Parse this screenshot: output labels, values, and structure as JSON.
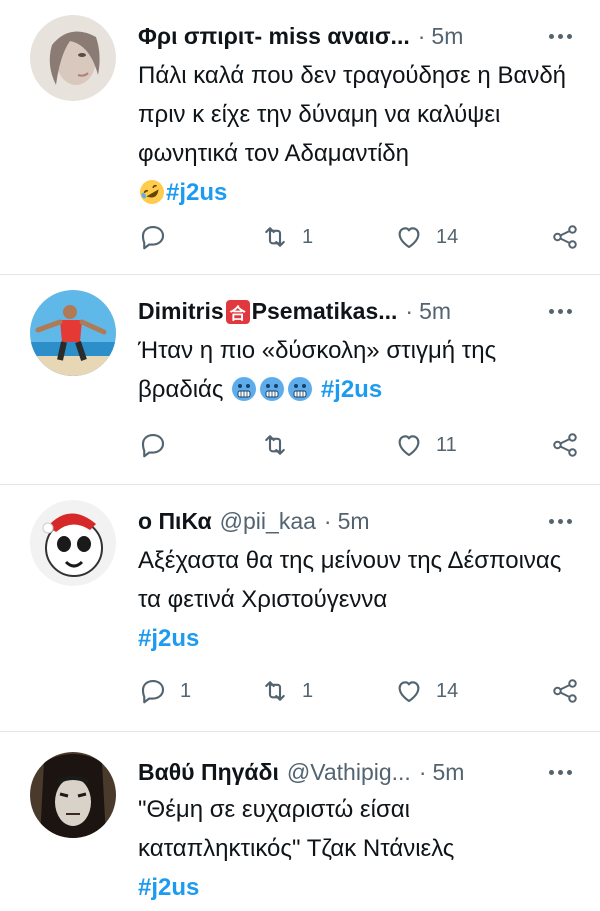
{
  "tweets": [
    {
      "name": "Φρι σπιριτ- miss αναισ...",
      "handle": "",
      "time": "5m",
      "text": "Πάλι καλά που δεν τραγούδησε η Βανδή πριν κ είχε την δύναμη να καλύψει φωνητικά τον Αδαμαντίδη",
      "hashtag": "#j2us",
      "emoji": "rolling-on-floor-laughing",
      "replies": "",
      "retweets": "1",
      "likes": "14"
    },
    {
      "name_part1": "Dimitris",
      "name_badge": "合",
      "name_part2": "Psematikas...",
      "handle": "",
      "time": "5m",
      "text": "Ήταν η πιο «δύσκολη» στιγμή της βραδιάς",
      "hashtag": "#j2us",
      "emoji": "cold-face",
      "replies": "",
      "retweets": "",
      "likes": "11"
    },
    {
      "name": "ο ΠιΚα",
      "handle": "@pii_kaa",
      "time": "5m",
      "text": "Αξέχαστα θα της μείνουν της Δέσποινας τα φετινά Χριστούγεννα",
      "hashtag": "#j2us",
      "replies": "1",
      "retweets": "1",
      "likes": "14"
    },
    {
      "name": "Βαθύ Πηγάδι",
      "handle": "@Vathipig...",
      "time": "5m",
      "text": "\"Θέμη σε ευχαριστώ είσαι καταπληκτικός\" Τζακ Ντάνιελς",
      "hashtag": "#j2us"
    }
  ],
  "separator": "·",
  "colors": {
    "hashtag": "#1d9bf0",
    "secondary": "#536471",
    "border": "#e1e6ea"
  }
}
